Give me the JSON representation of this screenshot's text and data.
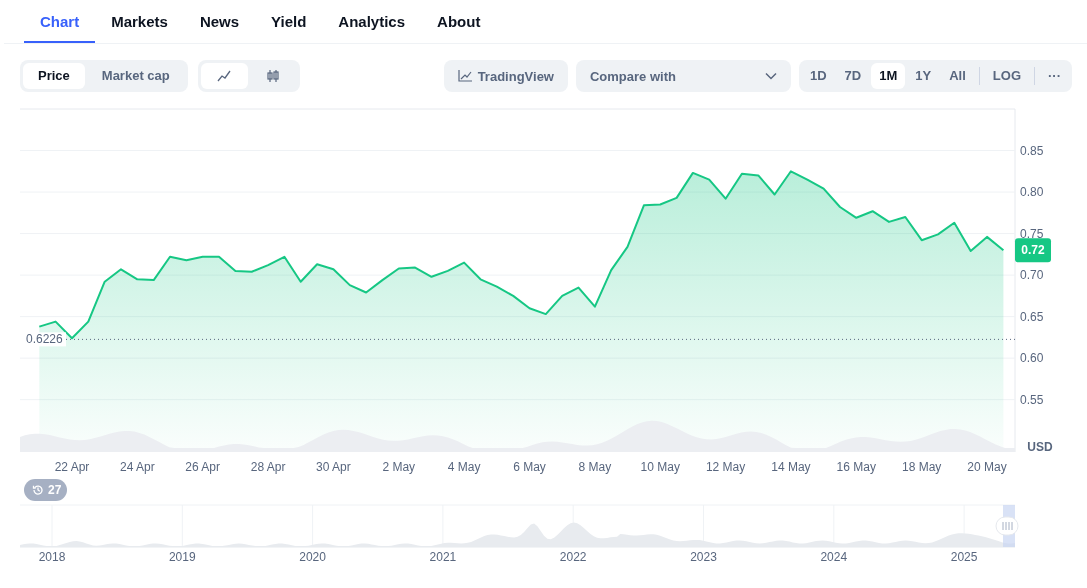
{
  "tabs": [
    {
      "label": "Chart",
      "selected": true
    },
    {
      "label": "Markets",
      "selected": false
    },
    {
      "label": "News",
      "selected": false
    },
    {
      "label": "Yield",
      "selected": false
    },
    {
      "label": "Analytics",
      "selected": false
    },
    {
      "label": "About",
      "selected": false
    }
  ],
  "toolbar": {
    "metric_toggle": [
      {
        "label": "Price",
        "selected": true
      },
      {
        "label": "Market cap",
        "selected": false
      }
    ],
    "chart_style_toggle": [
      {
        "kind": "line",
        "selected": true
      },
      {
        "kind": "candles",
        "selected": false
      }
    ],
    "tradingview_button": "TradingView",
    "compare_dropdown": "Compare with",
    "ranges": [
      {
        "label": "1D",
        "selected": false
      },
      {
        "label": "7D",
        "selected": false
      },
      {
        "label": "1M",
        "selected": true
      },
      {
        "label": "1Y",
        "selected": false
      },
      {
        "label": "All",
        "selected": false
      }
    ],
    "log_button": "LOG",
    "more_button": "···"
  },
  "chart": {
    "current_price": "0.72",
    "currency": "USD",
    "chart_data": {
      "type": "area",
      "ylim": [
        0.487,
        0.9
      ],
      "grid": true,
      "categories": [
        null,
        null,
        "22 Apr",
        null,
        null,
        null,
        "24 Apr",
        null,
        null,
        null,
        "26 Apr",
        null,
        null,
        null,
        "28 Apr",
        null,
        null,
        null,
        "30 Apr",
        null,
        null,
        null,
        "2 May",
        null,
        null,
        null,
        "4 May",
        null,
        null,
        null,
        "6 May",
        null,
        null,
        null,
        "8 May",
        null,
        null,
        null,
        "10 May",
        null,
        null,
        null,
        "12 May",
        null,
        null,
        null,
        "14 May",
        null,
        null,
        null,
        "16 May",
        null,
        null,
        null,
        "18 May",
        null,
        null,
        null,
        "20 May",
        null
      ],
      "yticks": [
        {
          "value": 0.55,
          "label": "0.55"
        },
        {
          "value": 0.6,
          "label": "0.60"
        },
        {
          "value": 0.65,
          "label": "0.65"
        },
        {
          "value": 0.7,
          "label": "0.70"
        },
        {
          "value": 0.75,
          "label": "0.75"
        },
        {
          "value": 0.8,
          "label": "0.80"
        },
        {
          "value": 0.85,
          "label": "0.85"
        }
      ],
      "series": [
        {
          "color": "#16c784",
          "values": [
            0.638,
            0.644,
            0.624,
            0.644,
            0.692,
            0.707,
            0.695,
            0.694,
            0.722,
            0.718,
            0.722,
            0.722,
            0.705,
            0.704,
            0.712,
            0.722,
            0.692,
            0.713,
            0.707,
            0.688,
            0.679,
            0.694,
            0.708,
            0.709,
            0.698,
            0.705,
            0.715,
            0.695,
            0.686,
            0.675,
            0.66,
            0.653,
            0.675,
            0.685,
            0.662,
            0.706,
            0.734,
            0.784,
            0.785,
            0.793,
            0.823,
            0.815,
            0.792,
            0.822,
            0.82,
            0.797,
            0.825,
            0.815,
            0.804,
            0.782,
            0.769,
            0.777,
            0.764,
            0.77,
            0.742,
            0.749,
            0.763,
            0.729,
            0.746,
            0.73
          ]
        }
      ],
      "ref_lines": [
        {
          "axis": "y",
          "value": 0.6226,
          "label": "0.6226"
        }
      ]
    }
  },
  "history_badge": "27",
  "navigator": {
    "years": [
      "2018",
      "2019",
      "2020",
      "2021",
      "2022",
      "2023",
      "2024",
      "2025"
    ]
  }
}
